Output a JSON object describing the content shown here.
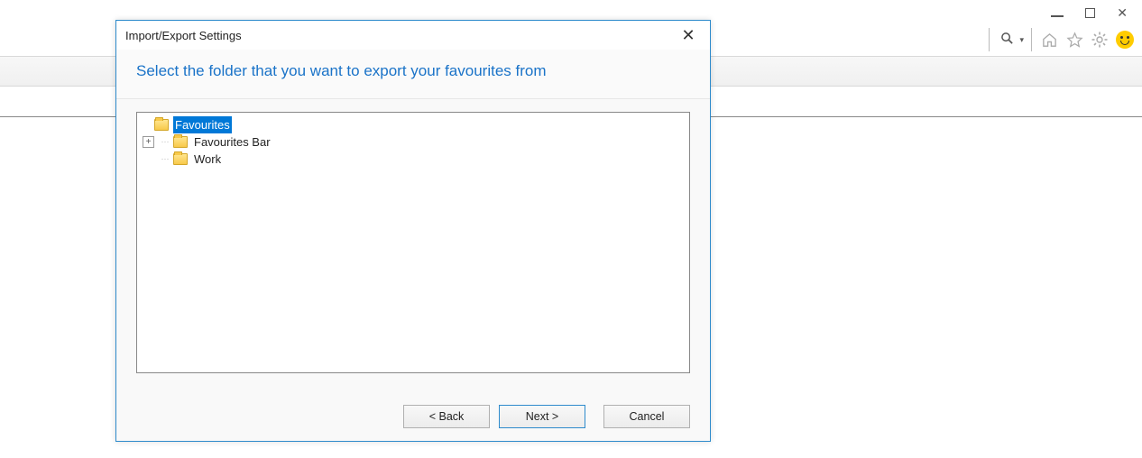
{
  "window": {
    "title_hint": ""
  },
  "dialog": {
    "title": "Import/Export Settings",
    "heading": "Select the folder that you want to export your favourites from",
    "tree": {
      "root": {
        "label": "Favourites",
        "selected": true
      },
      "children": [
        {
          "label": "Favourites Bar",
          "expandable": true,
          "expanded": false
        },
        {
          "label": "Work",
          "expandable": false
        }
      ]
    },
    "buttons": {
      "back": "< Back",
      "next": "Next >",
      "cancel": "Cancel"
    }
  }
}
